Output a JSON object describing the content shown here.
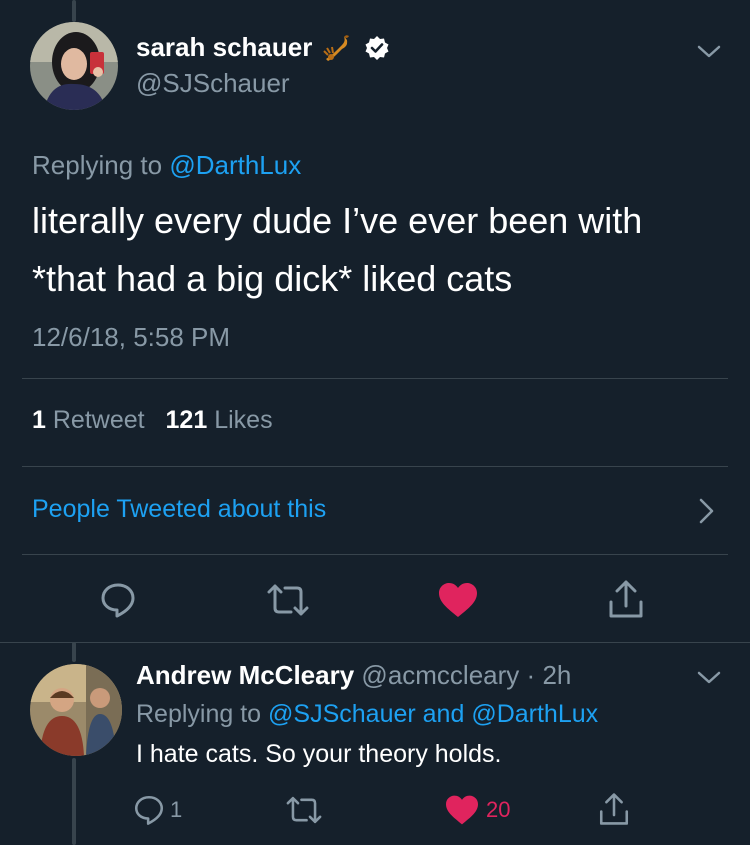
{
  "main_tweet": {
    "display_name": "sarah schauer",
    "handle": "@SJSchauer",
    "replying_prefix": "Replying to",
    "replying_to": "@DarthLux",
    "text_line1": "literally every dude I’ve ever been with",
    "text_line2": "*that had a big dick* liked cats",
    "timestamp": "12/6/18, 5:58 PM",
    "retweet_count": "1",
    "retweet_label": "Retweet",
    "like_count": "121",
    "like_label": "Likes",
    "people_tweeted_label": "People Tweeted about this",
    "accent_color": "#1da1f2",
    "like_color": "#e0245e"
  },
  "reply": {
    "display_name": "Andrew McCleary",
    "handle": "@acmccleary",
    "time_sep": "·",
    "time": "2h",
    "replying_prefix": "Replying to",
    "replying_to_1": "@SJSchauer",
    "replying_and": "and",
    "replying_to_2": "@DarthLux",
    "text": "I hate cats. So your theory holds.",
    "reply_count": "1",
    "like_count": "20"
  }
}
